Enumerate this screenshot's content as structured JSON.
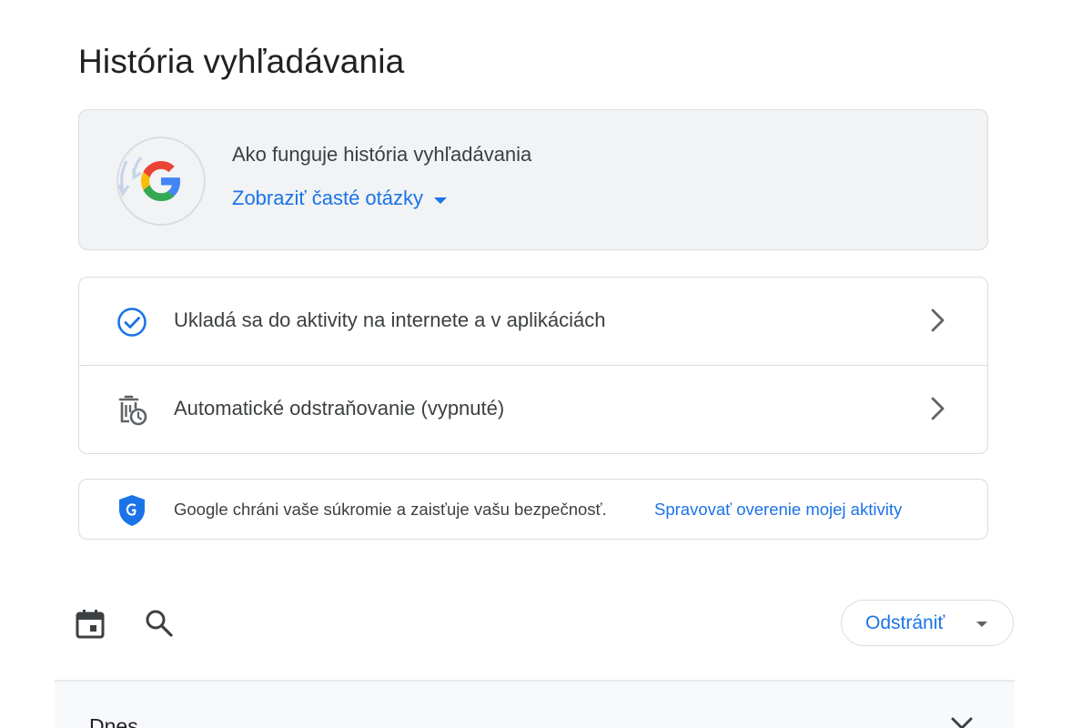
{
  "page": {
    "title": "História vyhľadávania"
  },
  "info_card": {
    "heading": "Ako funguje história vyhľadávania",
    "faq_link": "Zobraziť časté otázky",
    "logo_icon": "google-g-logo"
  },
  "settings": {
    "items": [
      {
        "label": "Ukladá sa do aktivity na internete a v aplikáciách",
        "icon": "check-circle-icon"
      },
      {
        "label": "Automatické odstraňovanie (vypnuté)",
        "icon": "auto-delete-icon"
      }
    ]
  },
  "privacy": {
    "text": "Google chráni vaše súkromie a zaisťuje vašu bezpečnosť.",
    "link": "Spravovať overenie mojej aktivity",
    "icon": "google-shield-icon"
  },
  "toolbar": {
    "calendar_icon": "calendar-icon",
    "search_icon": "search-icon",
    "delete_label": "Odstrániť"
  },
  "day_section": {
    "label": "Dnes"
  },
  "colors": {
    "accent": "#1a73e8",
    "text": "#202124",
    "secondary_text": "#3c4043",
    "border": "#dadce0",
    "card_bg": "#f1f3f4",
    "shield": "#1a73e8"
  }
}
